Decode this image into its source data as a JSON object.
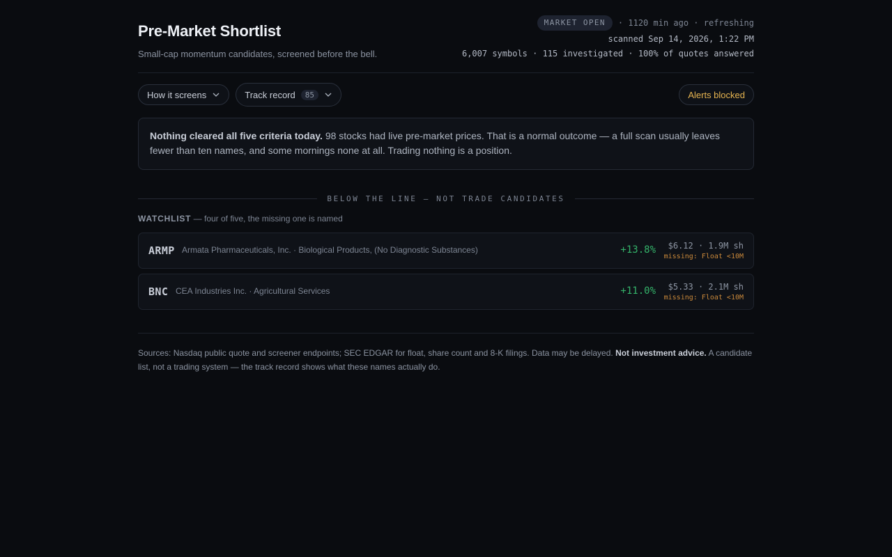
{
  "header": {
    "title": "Pre-Market Shortlist",
    "subtitle": "Small-cap momentum candidates, screened before the bell.",
    "market_badge": "MARKET OPEN",
    "status": "· 1120 min ago · refreshing",
    "scanned": "scanned Sep 14, 2026, 1:22 PM",
    "stats": "6,007 symbols · 115 investigated · 100% of quotes answered"
  },
  "toolbar": {
    "how_it_screens": "How it screens",
    "track_record": "Track record",
    "track_record_count": "85",
    "alerts": "Alerts blocked"
  },
  "notice": {
    "bold": "Nothing cleared all five criteria today.",
    "text": " 98 stocks had live pre-market prices. That is a normal outcome — a full scan usually leaves fewer than ten names, and some mornings none at all. Trading nothing is a position."
  },
  "below_line": {
    "label": "BELOW THE LINE — NOT TRADE CANDIDATES"
  },
  "watchlist": {
    "heading": "WATCHLIST",
    "subheading": " — four of five, the missing one is named",
    "rows": [
      {
        "ticker": "ARMP",
        "company": "Armata Pharmaceuticals, Inc. · Biological Products, (No Diagnostic Substances)",
        "change": "+13.8%",
        "price": "$6.12 · 1.9M sh",
        "missing": "missing: Float <10M"
      },
      {
        "ticker": "BNC",
        "company": "CEA Industries Inc. · Agricultural Services",
        "change": "+11.0%",
        "price": "$5.33 · 2.1M sh",
        "missing": "missing: Float <10M"
      }
    ]
  },
  "footer": {
    "text": "Sources: Nasdaq public quote and screener endpoints; SEC EDGAR for float, share count and 8-K filings. Data may be delayed. ",
    "bold": "Not investment advice.",
    "tail": " A candidate list, not a trading system — the track record shows what these names actually do."
  },
  "colors": {
    "background": "#0a0c10",
    "positive": "#34b36a",
    "warning": "#e6b450",
    "missing": "#c9883a"
  },
  "icons": {
    "dropdown": "chevron-down-icon"
  }
}
